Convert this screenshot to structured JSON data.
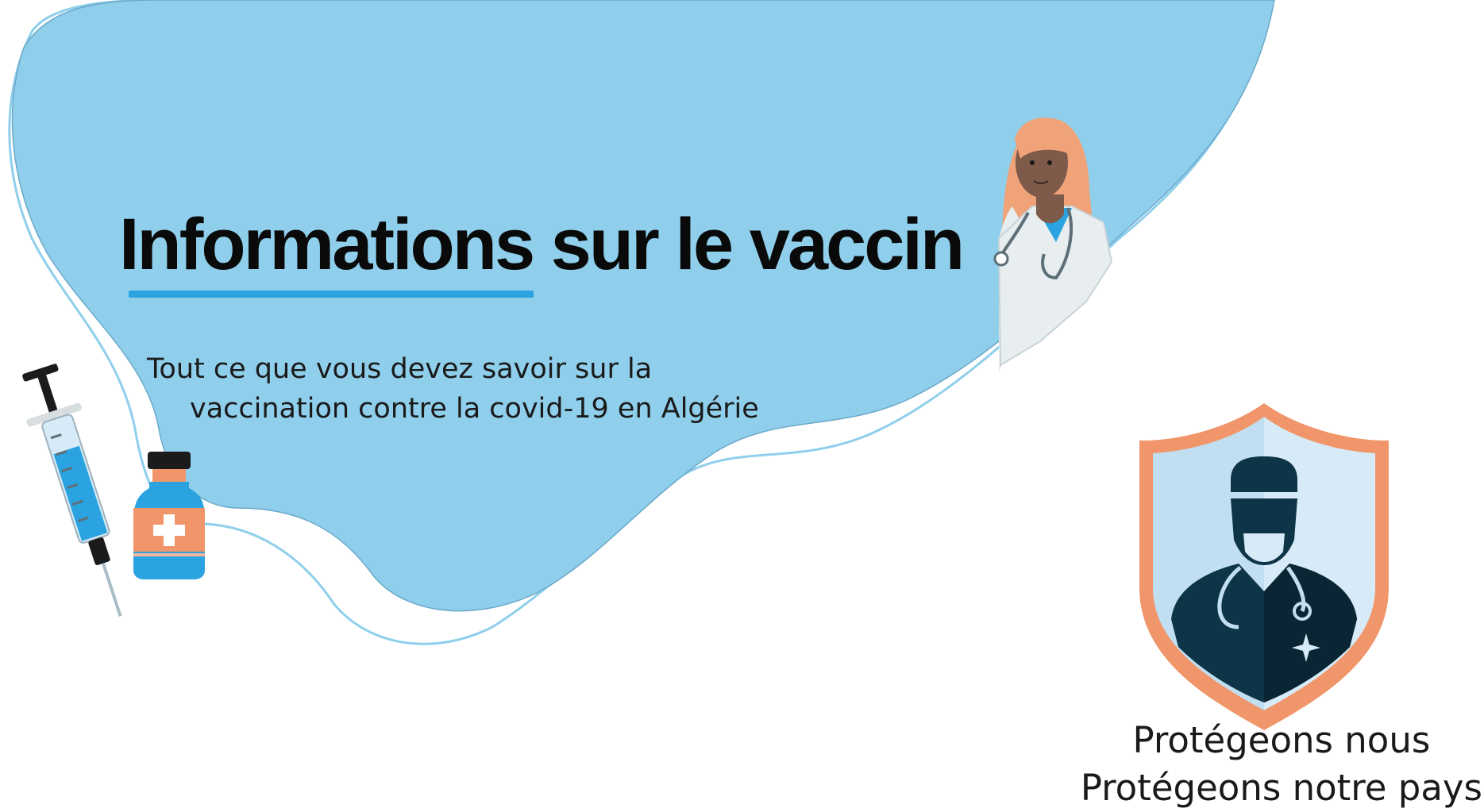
{
  "hero": {
    "title": "Informations sur le vaccin",
    "subtitle_line1": "Tout ce que vous devez savoir sur la",
    "subtitle_line2": "vaccination contre la covid-19 en Algérie"
  },
  "slogan": {
    "line1": "Protégeons nous",
    "line2": "Protégeons notre pays"
  },
  "colors": {
    "blob": "#8fcfec",
    "accent": "#2aa3e0",
    "shield_orange": "#f0966a",
    "shield_light": "#d6ebf7",
    "doctor_dark": "#0e3448"
  },
  "icons": [
    "syringe-icon",
    "vaccine-bottle-icon",
    "doctor-illustration",
    "shield-icon",
    "medic-icon",
    "stethoscope-icon"
  ]
}
